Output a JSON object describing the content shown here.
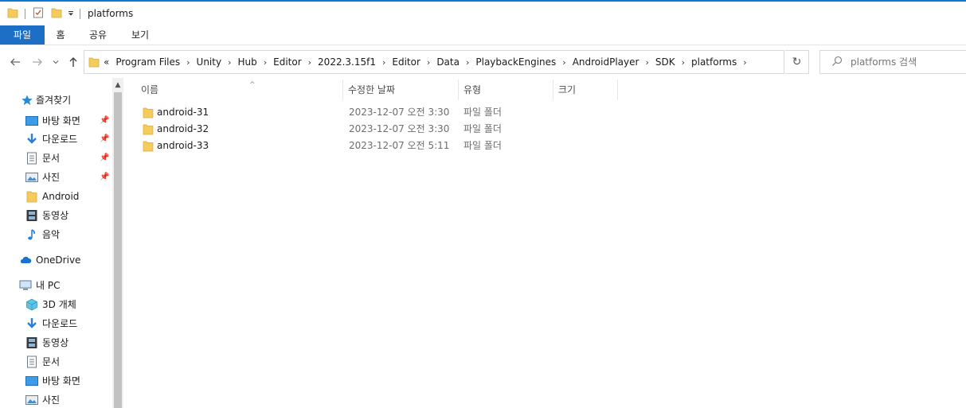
{
  "window": {
    "title": "platforms"
  },
  "ribbon": {
    "tabs": [
      "파일",
      "홈",
      "공유",
      "보기"
    ]
  },
  "address": {
    "crumbs": [
      "Program Files",
      "Unity",
      "Hub",
      "Editor",
      "2022.3.15f1",
      "Editor",
      "Data",
      "PlaybackEngines",
      "AndroidPlayer",
      "SDK",
      "platforms"
    ],
    "overflow": "«"
  },
  "search": {
    "placeholder": "platforms 검색"
  },
  "nav": {
    "quick_access": "즐겨찾기",
    "quick_items": [
      "바탕 화면",
      "다운로드",
      "문서",
      "사진",
      "Android",
      "동영상",
      "음악"
    ],
    "onedrive": "OneDrive",
    "thispc": "내 PC",
    "pc_items": [
      "3D 개체",
      "다운로드",
      "동영상",
      "문서",
      "바탕 화면",
      "사진"
    ]
  },
  "columns": {
    "name": "이름",
    "modified": "수정한 날짜",
    "type": "유형",
    "size": "크기"
  },
  "files": [
    {
      "name": "android-31",
      "modified": "2023-12-07 오전 3:30",
      "type": "파일 폴더"
    },
    {
      "name": "android-32",
      "modified": "2023-12-07 오전 3:30",
      "type": "파일 폴더"
    },
    {
      "name": "android-33",
      "modified": "2023-12-07 오전 5:11",
      "type": "파일 폴더"
    }
  ],
  "colors": {
    "accent": "#1c6fc4",
    "folder": "#f5cb5c",
    "topline": "#0a7ad6"
  }
}
